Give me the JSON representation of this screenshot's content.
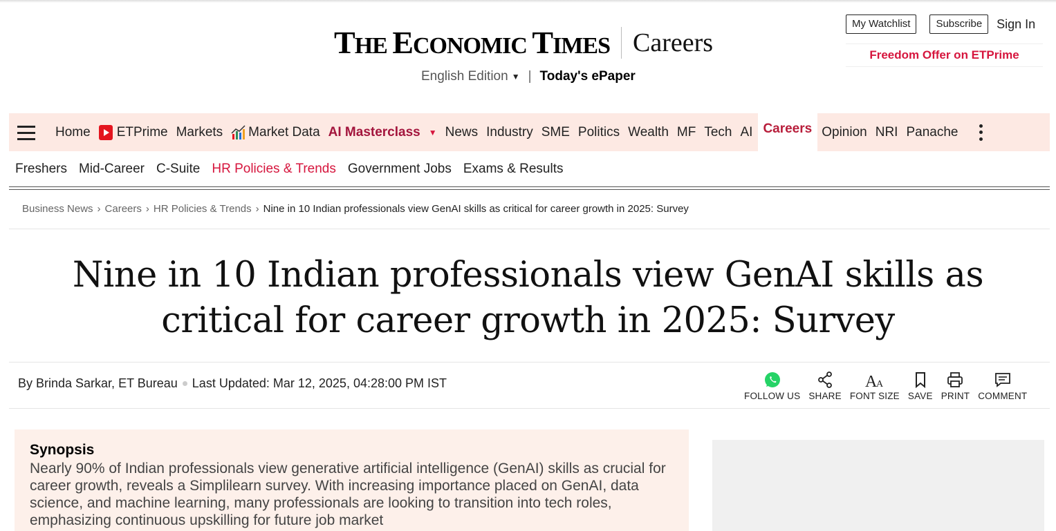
{
  "header": {
    "logo": "The Economic Times",
    "section": "Careers",
    "edition": "English Edition",
    "epaper": "Today's ePaper",
    "watchlist": "My Watchlist",
    "subscribe": "Subscribe",
    "signin": "Sign In",
    "offer": "Freedom Offer on ETPrime"
  },
  "nav": {
    "items": [
      "Home",
      "ETPrime",
      "Markets",
      "Market Data",
      "AI Masterclass",
      "News",
      "Industry",
      "SME",
      "Politics",
      "Wealth",
      "MF",
      "Tech",
      "AI",
      "Careers",
      "Opinion",
      "NRI",
      "Panache"
    ]
  },
  "subnav": {
    "items": [
      "Freshers",
      "Mid-Career",
      "C-Suite",
      "HR Policies & Trends",
      "Government Jobs",
      "Exams & Results"
    ]
  },
  "breadcrumb": [
    "Business News",
    "Careers",
    "HR Policies & Trends",
    "Nine in 10 Indian professionals view GenAI skills as critical for career growth in 2025: Survey"
  ],
  "article": {
    "headline": "Nine in 10 Indian professionals view GenAI skills as critical for career growth in 2025: Survey",
    "author": "By Brinda Sarkar, ET Bureau",
    "updated": "Last Updated: Mar 12, 2025, 04:28:00 PM IST"
  },
  "actions": {
    "follow": "FOLLOW US",
    "share": "SHARE",
    "font_size": "FONT SIZE",
    "save": "SAVE",
    "print": "PRINT",
    "comment": "COMMENT"
  },
  "synopsis": {
    "title": "Synopsis",
    "text": "Nearly 90% of Indian professionals view generative artificial intelligence (GenAI) skills as crucial for career growth, reveals a Simplilearn survey. With increasing importance placed on GenAI, data science, and machine learning, many professionals are looking to transition into tech roles, emphasizing continuous upskilling for future job market"
  },
  "colors": {
    "brand_red": "#d6153d",
    "nav_bg": "#fde9e3",
    "synopsis_bg": "#fdf0ea",
    "whatsapp": "#25d366"
  }
}
